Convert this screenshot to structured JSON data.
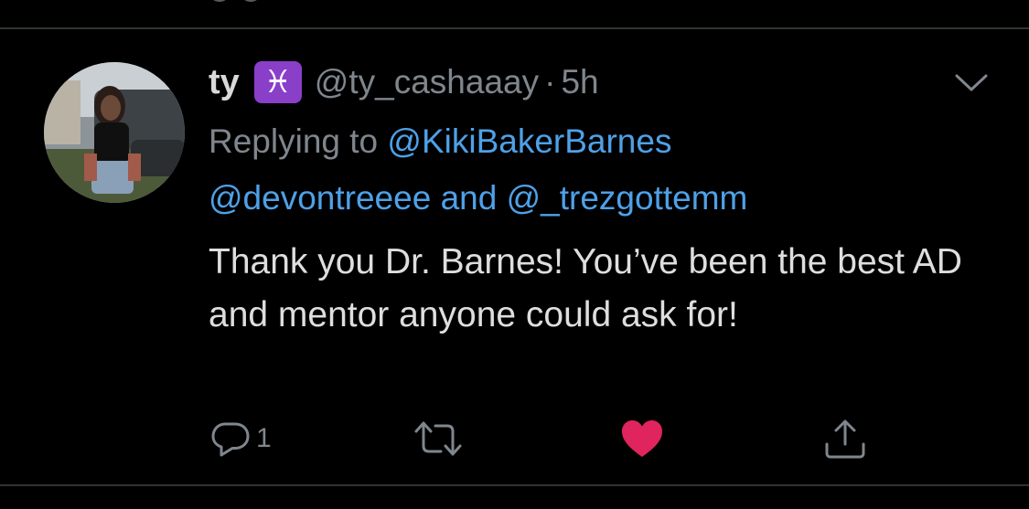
{
  "tweet": {
    "display_name": "ty",
    "zodiac_badge": "♓",
    "handle": "@ty_cashaaay",
    "separator": "·",
    "time": "5h",
    "replying_prefix": "Replying to",
    "mention_1": "@KikiBakerBarnes",
    "mention_2": "@devontreeee",
    "mention_join": "and",
    "mention_3": "@_trezgottemm",
    "text": "Thank you Dr. Barnes! You’ve been the best AD and mentor anyone could ask for!",
    "reply_count": "1",
    "liked": true
  },
  "icons": {
    "more": "chevron-down-icon",
    "reply": "reply-bubble-icon",
    "retweet": "retweet-icon",
    "like": "heart-icon",
    "share": "share-icon"
  },
  "colors": {
    "background": "#000000",
    "divider": "#2f3336",
    "link": "#4ea1e8",
    "muted": "#7f868d",
    "like": "#e0245e",
    "badge": "#8a3fc9"
  }
}
